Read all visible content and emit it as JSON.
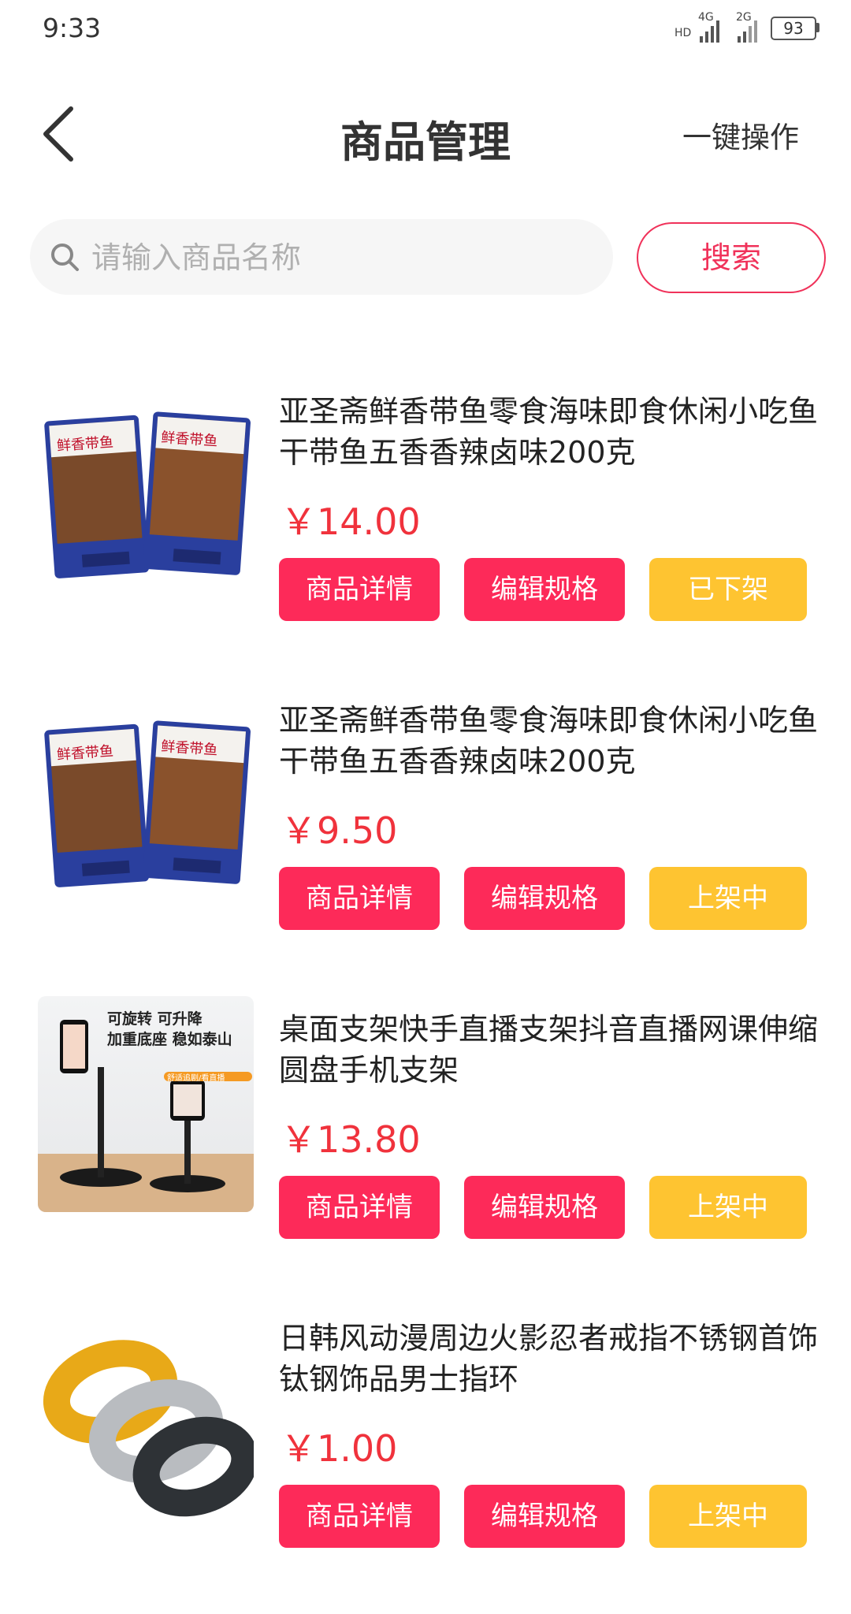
{
  "status_bar": {
    "time": "9:33",
    "network_1": "4G",
    "network_1_prefix": "HD",
    "network_2": "2G",
    "battery": "93"
  },
  "header": {
    "title": "商品管理",
    "action": "一键操作"
  },
  "search": {
    "placeholder": "请输入商品名称",
    "button": "搜索"
  },
  "colors": {
    "accent_red": "#fd2a59",
    "price_red": "#f0323c",
    "status_yellow": "#fec431"
  },
  "products": [
    {
      "name": "亚圣斋鲜香带鱼零食海味即食休闲小吃鱼干带鱼五香香辣卤味200克",
      "price": "￥14.00",
      "detail_label": "商品详情",
      "spec_label": "编辑规格",
      "status_label": "已下架",
      "image": "fish-snack-package-image"
    },
    {
      "name": "亚圣斋鲜香带鱼零食海味即食休闲小吃鱼干带鱼五香香辣卤味200克",
      "price": "￥9.50",
      "detail_label": "商品详情",
      "spec_label": "编辑规格",
      "status_label": "上架中",
      "image": "fish-snack-package-image"
    },
    {
      "name": "桌面支架快手直播支架抖音直播网课伸缩圆盘手机支架",
      "price": "￥13.80",
      "detail_label": "商品详情",
      "spec_label": "编辑规格",
      "status_label": "上架中",
      "image": "phone-stand-image",
      "image_text": [
        "可旋转 可升降",
        "加重底座 稳如泰山",
        "舒适追剧/看直播"
      ]
    },
    {
      "name": "日韩风动漫周边火影忍者戒指不锈钢首饰钛钢饰品男士指环",
      "price": "￥1.00",
      "detail_label": "商品详情",
      "spec_label": "编辑规格",
      "status_label": "上架中",
      "image": "rings-image"
    }
  ]
}
